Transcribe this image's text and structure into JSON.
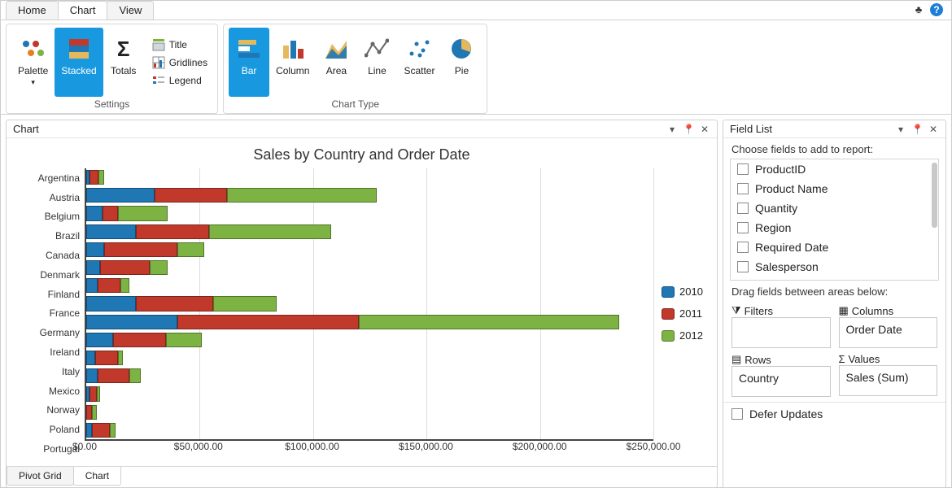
{
  "top_tabs": {
    "items": [
      "Home",
      "Chart",
      "View"
    ],
    "active": 1
  },
  "ribbon": {
    "groups": [
      {
        "caption": "Settings",
        "buttons": [
          {
            "id": "palette",
            "label": "Palette",
            "dropdown": true
          },
          {
            "id": "stacked",
            "label": "Stacked",
            "active": true
          },
          {
            "id": "totals",
            "label": "Totals"
          }
        ],
        "mini": [
          {
            "id": "title",
            "label": "Title"
          },
          {
            "id": "gridlines",
            "label": "Gridlines"
          },
          {
            "id": "legend",
            "label": "Legend"
          }
        ]
      },
      {
        "caption": "Chart Type",
        "buttons": [
          {
            "id": "bar",
            "label": "Bar",
            "active": true
          },
          {
            "id": "column",
            "label": "Column"
          },
          {
            "id": "area",
            "label": "Area"
          },
          {
            "id": "line",
            "label": "Line"
          },
          {
            "id": "scatter",
            "label": "Scatter"
          },
          {
            "id": "pie",
            "label": "Pie"
          }
        ]
      }
    ]
  },
  "chart_pane": {
    "title": "Chart"
  },
  "chart_data": {
    "type": "bar",
    "orientation": "horizontal",
    "stacked": true,
    "title": "Sales by Country and Order Date",
    "xlabel": "",
    "ylabel": "",
    "categories": [
      "Argentina",
      "Austria",
      "Belgium",
      "Brazil",
      "Canada",
      "Denmark",
      "Finland",
      "France",
      "Germany",
      "Ireland",
      "Italy",
      "Mexico",
      "Norway",
      "Poland",
      "Portugal"
    ],
    "series": [
      {
        "name": "2010",
        "color": "#1f77b4",
        "values": [
          1500,
          30000,
          7000,
          22000,
          8000,
          6000,
          5000,
          22000,
          40000,
          12000,
          4000,
          5000,
          1500,
          0,
          2500
        ]
      },
      {
        "name": "2011",
        "color": "#c0392b",
        "values": [
          4000,
          32000,
          7000,
          32000,
          32000,
          22000,
          10000,
          34000,
          80000,
          23000,
          10000,
          14000,
          3000,
          2500,
          8000
        ]
      },
      {
        "name": "2012",
        "color": "#7cb342",
        "values": [
          2500,
          66000,
          22000,
          54000,
          12000,
          8000,
          4000,
          28000,
          115000,
          16000,
          2000,
          5000,
          1500,
          2000,
          2500
        ]
      }
    ],
    "xlim": [
      0,
      250000
    ],
    "x_ticks": [
      0,
      50000,
      100000,
      150000,
      200000,
      250000
    ],
    "x_tick_labels": [
      "$0.00",
      "$50,000.00",
      "$100,000.00",
      "$150,000.00",
      "$200,000.00",
      "$250,000.00"
    ],
    "legend_position": "right"
  },
  "bottom_tabs": {
    "items": [
      "Pivot Grid",
      "Chart"
    ],
    "active": 1
  },
  "field_list": {
    "title": "Field List",
    "choose_label": "Choose fields to add to report:",
    "fields": [
      "ProductID",
      "Product Name",
      "Quantity",
      "Region",
      "Required Date",
      "Salesperson"
    ],
    "drag_label": "Drag fields between areas below:",
    "areas": {
      "filters": {
        "label": "Filters",
        "value": ""
      },
      "columns": {
        "label": "Columns",
        "value": "Order Date"
      },
      "rows": {
        "label": "Rows",
        "value": "Country"
      },
      "values": {
        "label": "Values",
        "value": "Sales (Sum)"
      }
    },
    "defer_label": "Defer Updates"
  }
}
